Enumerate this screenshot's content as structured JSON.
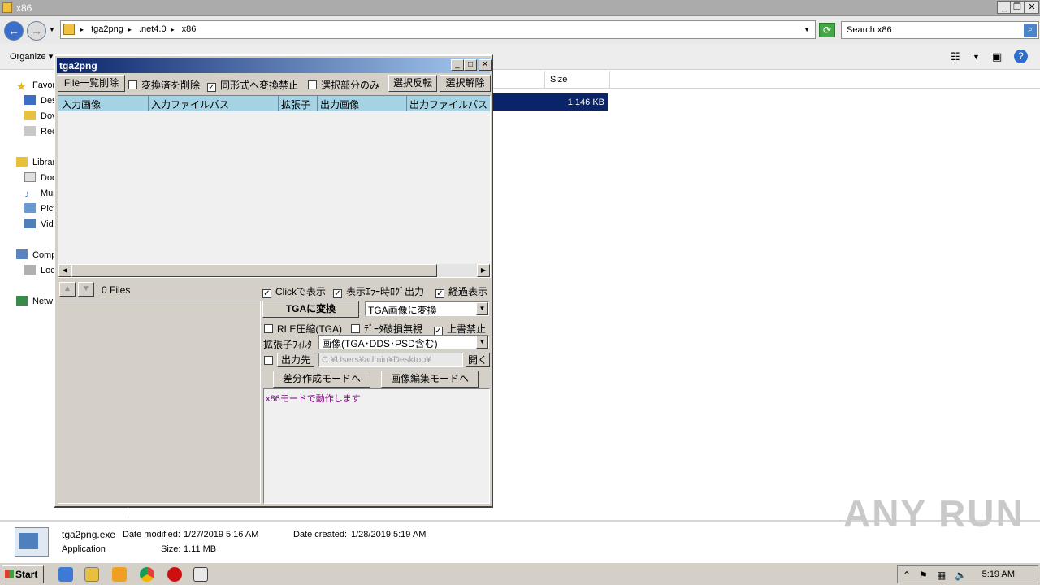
{
  "explorer": {
    "title": "x86",
    "breadcrumbs": [
      "tga2png",
      ".net4.0",
      "x86"
    ],
    "search_placeholder": "Search x86",
    "organize_label": "Organize",
    "column_size": "Size",
    "selected_size": "1,146 KB",
    "nav_items": [
      "Favor",
      "Des",
      "Dov",
      "Rec",
      "Librar",
      "Doc",
      "Mus",
      "Pict",
      "Vide",
      "Comp",
      "Loc",
      "Netw"
    ]
  },
  "details": {
    "filename": "tga2png.exe",
    "modified_label": "Date modified:",
    "modified_value": "1/27/2019 5:16 AM",
    "created_label": "Date created:",
    "created_value": "1/28/2019 5:19 AM",
    "type": "Application",
    "size_label": "Size:",
    "size_value": "1.11 MB"
  },
  "watermark": "ANY RUN",
  "taskbar": {
    "start_label": "Start",
    "clock": "5:19 AM"
  },
  "tga2png": {
    "title": "tga2png",
    "file_clear_button": "File一覧削除",
    "chk_delete_converted": "変換済を削除",
    "chk_no_same_format": "同形式へ変換禁止",
    "chk_selected_only": "選択部分のみ",
    "invert_selection_button": "選択反転",
    "clear_selection_button": "選択解除",
    "columns": [
      "入力画像",
      "入力ファイルパス",
      "拡張子",
      "出力画像",
      "出力ファイルパス"
    ],
    "file_count": "0 Files",
    "chk_click_show": "Clickで表示",
    "chk_error_log": "表示ｴﾗｰ時ﾛｸﾞ出力",
    "chk_progress": "経過表示",
    "convert_button": "TGAに変換",
    "convert_mode": "TGA画像に変換",
    "chk_rle": "RLE圧縮(TGA)",
    "chk_ignore_corrupt": "ﾃﾞｰﾀ破損無視",
    "chk_no_overwrite": "上書禁止",
    "ext_filter_label": "拡張子ﾌｨﾙﾀ",
    "ext_filter_value": "画像(TGA･DDS･PSD含む)",
    "output_dir_button": "出力先",
    "output_path": "C:¥Users¥admin¥Desktop¥",
    "open_button": "開く",
    "diff_mode_button": "差分作成モードへ",
    "edit_mode_button": "画像編集モードへ",
    "log_text": "x86モードで動作します"
  }
}
